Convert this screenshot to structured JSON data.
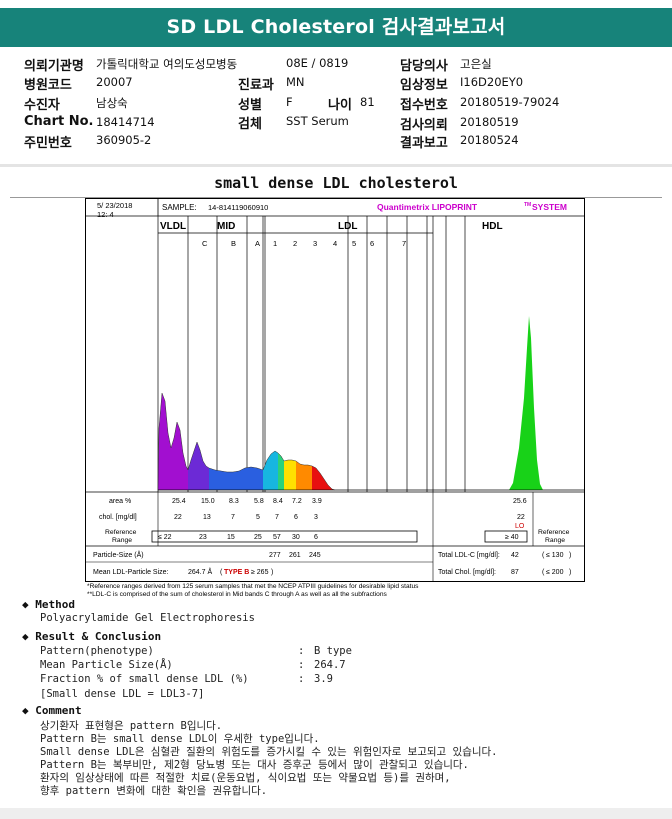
{
  "title": "SD LDL Cholesterol 검사결과보고서",
  "patient": {
    "institution_label": "의뢰기관명",
    "institution": "가톨릭대학교 여의도성모병동",
    "ward_no": "08E / 0819",
    "doctor_label": "담당의사",
    "doctor": "고은실",
    "hospital_code_label": "병원코드",
    "hospital_code": "20007",
    "dept_label": "진료과",
    "dept": "MN",
    "clinical_label": "임상정보",
    "clinical": "I16D20EY0",
    "patient_name_label": "수진자",
    "patient_name": "남상숙",
    "sex_label": "성별",
    "sex": "F",
    "age_label": "나이",
    "age": "81",
    "receipt_label": "접수번호",
    "receipt": "20180519-79024",
    "chart_label": "Chart No.",
    "chart": "18414714",
    "specimen_label": "검체",
    "specimen": "SST Serum",
    "request_date_label": "검사의뢰",
    "request_date": "20180519",
    "id_label": "주민번호",
    "id": "360905-2",
    "report_date_label": "결과보고",
    "report_date": "20180524"
  },
  "subtitle": "small dense LDL cholesterol",
  "chart_data": {
    "type": "area",
    "date": "5/ 23/2018",
    "time": "12: 4",
    "sample_label": "SAMPLE:",
    "sample_id": "14-814119060910",
    "brand": "Quantimetrix LIPOPRINT",
    "brand_tm": "TM",
    "brand_suffix": "SYSTEM",
    "groups": [
      "VLDL",
      "MID",
      "LDL",
      "HDL"
    ],
    "mid_bands": [
      "C",
      "B",
      "A"
    ],
    "ldl_bands": [
      "1",
      "2",
      "3",
      "4",
      "5",
      "6",
      "7"
    ],
    "row_labels": {
      "area": "area %",
      "chol": "chol. [mg/dl]",
      "ref": "Reference Range",
      "particle": "Particle-Size (Å)",
      "mean": "Mean LDL-Particle Size:",
      "total_ldl": "Total LDL-C [mg/dl]:",
      "total_chol": "Total Chol. [mg/dl]:",
      "right_ref": "Reference Range"
    },
    "area_percent": [
      "25.4",
      "15.0",
      "8.3",
      "5.8",
      "8.4",
      "7.2",
      "3.9"
    ],
    "chol_mgdl": [
      "22",
      "13",
      "7",
      "5",
      "7",
      "6",
      "3"
    ],
    "ref_range": [
      "≤ 22",
      "23",
      "15",
      "25",
      "57",
      "30",
      "6"
    ],
    "hdl_area": "25.6",
    "hdl_chol": "22",
    "hdl_flag": "LO",
    "hdl_ref": "≥ 40",
    "particle_sizes": [
      "277",
      "261",
      "245"
    ],
    "mean_particle_size": "264.7 Å",
    "type_label": "TYPE B",
    "type_ref": "≥ 265",
    "total_ldl": "42",
    "total_ldl_ref": "≤ 130",
    "total_chol": "87",
    "total_chol_ref": "≤ 200",
    "footnote1": "*Reference ranges derived from 125 serum samples that met the NCEP ATPIII guidelines for desirable lipid status",
    "footnote2": "**LDL-C is comprised of the sum of cholesterol in Mid bands C through A as well as all the subfractions"
  },
  "method": {
    "heading": "Method",
    "text": "Polyacrylamide Gel Electrophoresis"
  },
  "result": {
    "heading": "Result & Conclusion",
    "rows": [
      {
        "label": "Pattern(phenotype)",
        "colon": ":",
        "value": "B type"
      },
      {
        "label": "Mean Particle Size(Å)",
        "colon": ":",
        "value": "264.7"
      },
      {
        "label": "Fraction % of small dense LDL (%)",
        "colon": ":",
        "value": "3.9"
      }
    ],
    "note": "[Small dense LDL = LDL3-7]"
  },
  "comment": {
    "heading": "Comment",
    "lines": [
      "상기환자 표현형은 pattern B입니다.",
      "Pattern B는 small dense LDL이 우세한 type입니다.",
      "Small dense LDL은 심혈관 질환의 위험도를 증가시킬 수 있는 위험인자로 보고되고 있습니다.",
      "Pattern B는 복부비만, 제2형 당뇨병 또는 대사 증후군 등에서 많이 관찰되고 있습니다.",
      "환자의 임상상태에 따른 적절한 치료(운동요법, 식이요법 또는 약물요법 등)를 권하며,",
      "향후 pattern 변화에 대한 확인을 권유합니다."
    ]
  },
  "colors": {
    "header_bg": "#17837a",
    "vldl": "#a20fd0",
    "mid": "#2a5fe0",
    "ldl1": "#ffe000",
    "ldl2": "#ff8a00",
    "ldl3": "#e81010",
    "hdl": "#18d218",
    "brand": "#cc00cc",
    "type_b": "#cc0000"
  }
}
